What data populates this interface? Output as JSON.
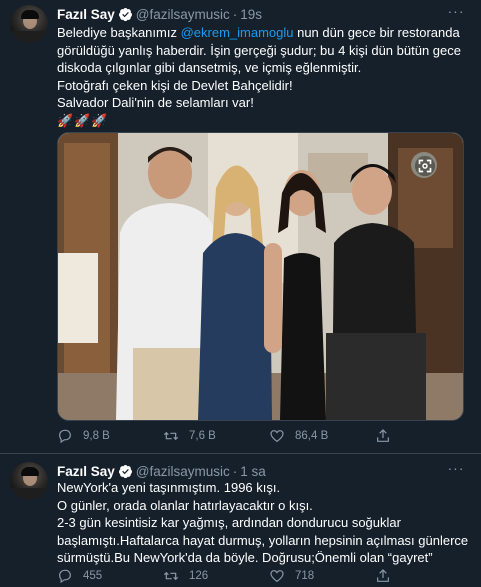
{
  "tweets": [
    {
      "name": "Fazıl Say",
      "handle": "@fazilsaymusic",
      "separator": "·",
      "time": "19s",
      "lines": [
        {
          "pre": "Belediye başkanımız ",
          "mention": "@ekrem_imamoglu",
          "post": " nun dün gece bir restoranda"
        },
        {
          "pre": "görüldüğü yanlış haberdir. İşin gerçeği şudur; bu 4 kişi dün bütün gece"
        },
        {
          "pre": "diskoda çılgınlar gibi dansetmiş, ve içmiş eğlenmiştir."
        },
        {
          "pre": "Fotoğrafı çeken kişi de Devlet Bahçelidir!"
        },
        {
          "pre": "Salvador Dali'nin de selamları var!"
        }
      ],
      "emoji": "🚀🚀🚀",
      "metrics": {
        "replies": "9,8 B",
        "retweets": "7,6 B",
        "likes": "86,4 B"
      }
    },
    {
      "name": "Fazıl Say",
      "handle": "@fazilsaymusic",
      "separator": "·",
      "time": "1 sa",
      "lines": [
        {
          "pre": "NewYork'a yeni taşınmıştım. 1996 kışı."
        },
        {
          "pre": "O günler, orada olanlar hatırlayacaktır o kışı."
        },
        {
          "pre": "2-3 gün kesintisiz kar yağmış, ardından dondurucu soğuklar"
        },
        {
          "pre": "başlamıştı.Haftalarca hayat durmuş, yolların hepsinin açılması günlerce"
        },
        {
          "pre": "sürmüştü.Bu NewYork'da da böyle. Doğrusu;Önemli olan “gayret”"
        }
      ],
      "metrics": {
        "replies": "455",
        "retweets": "126",
        "likes": "718"
      }
    }
  ],
  "icons": [
    "verified-badge-icon",
    "more-icon",
    "reply-icon",
    "retweet-icon",
    "like-icon",
    "share-icon",
    "expand-photo-icon"
  ],
  "colors": {
    "background": "#15202b",
    "text": "#ffffff",
    "secondary": "#8b98a5",
    "link": "#1d9bf0",
    "border": "#38444d"
  }
}
